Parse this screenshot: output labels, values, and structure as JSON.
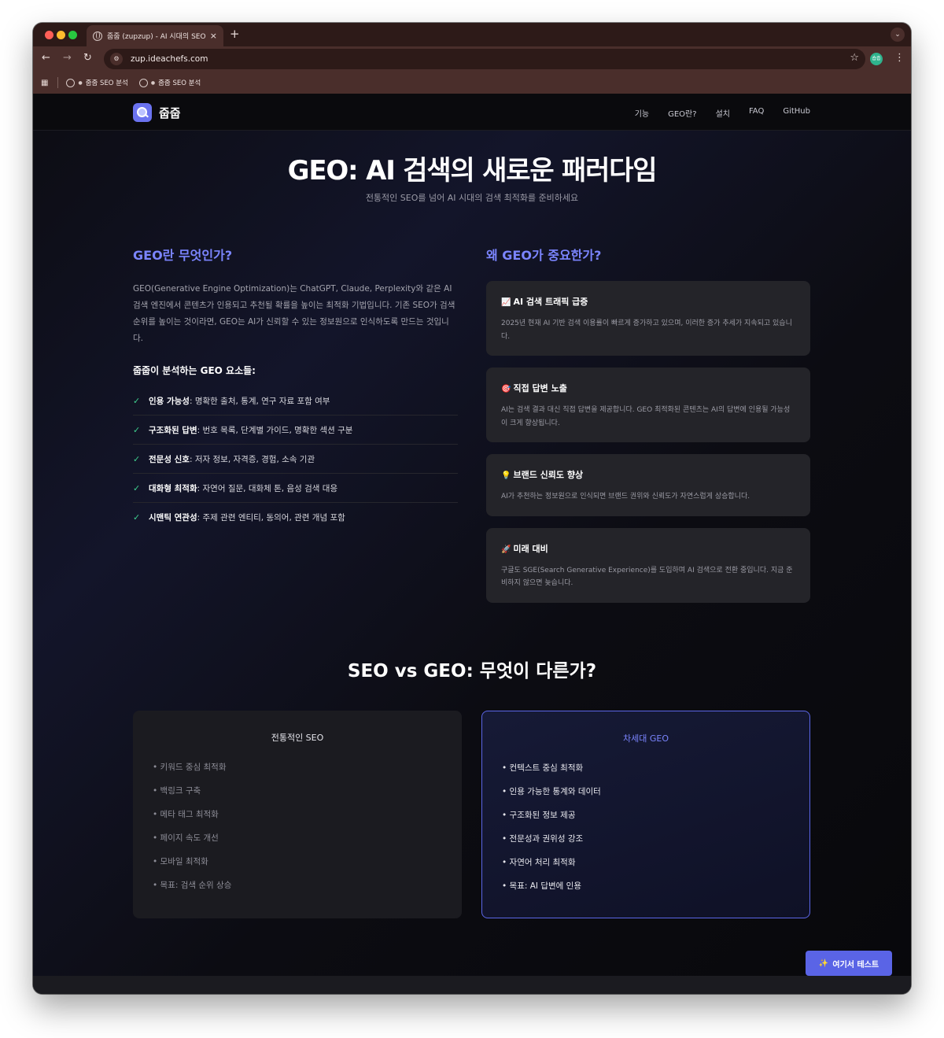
{
  "browser": {
    "tab_title": "줍줍 (zupzup) - AI 시대의 SEO 분석",
    "tab_close": "×",
    "new_tab": "+",
    "url": "zup.ideachefs.com",
    "profile_initials": "숍줍",
    "bookmarks": [
      {
        "label": "줍줍 SEO 분석"
      },
      {
        "label": "줍줍 SEO 분석"
      }
    ]
  },
  "site": {
    "logo_text": "줍줍",
    "nav": [
      "기능",
      "GEO란?",
      "설치",
      "FAQ",
      "GitHub"
    ]
  },
  "hero": {
    "title": "GEO: AI 검색의 새로운 패러다임",
    "subtitle": "전통적인 SEO를 넘어 AI 시대의 검색 최적화를 준비하세요"
  },
  "what_is": {
    "heading": "GEO란 무엇인가?",
    "description": "GEO(Generative Engine Optimization)는 ChatGPT, Claude, Perplexity와 같은 AI 검색 엔진에서 콘텐츠가 인용되고 추천될 확률을 높이는 최적화 기법입니다. 기존 SEO가 검색 순위를 높이는 것이라면, GEO는 AI가 신뢰할 수 있는 정보원으로 인식하도록 만드는 것입니다.",
    "factors_heading": "줍줍이 분석하는 GEO 요소들:",
    "factors": [
      {
        "name": "인용 가능성",
        "detail": ": 명확한 출처, 통계, 연구 자료 포함 여부"
      },
      {
        "name": "구조화된 답변",
        "detail": ": 번호 목록, 단계별 가이드, 명확한 섹션 구분"
      },
      {
        "name": "전문성 신호",
        "detail": ": 저자 정보, 자격증, 경험, 소속 기관"
      },
      {
        "name": "대화형 최적화",
        "detail": ": 자연어 질문, 대화체 톤, 음성 검색 대응"
      },
      {
        "name": "시맨틱 연관성",
        "detail": ": 주제 관련 엔티티, 동의어, 관련 개념 포함"
      }
    ]
  },
  "why": {
    "heading": "왜 GEO가 중요한가?",
    "cards": [
      {
        "emoji": "📈",
        "title": "AI 검색 트래픽 급증",
        "text": "2025년 현재 AI 기반 검색 이용률이 빠르게 증가하고 있으며, 이러한 증가 추세가 지속되고 있습니다."
      },
      {
        "emoji": "🎯",
        "title": "직접 답변 노출",
        "text": "AI는 검색 결과 대신 직접 답변을 제공합니다. GEO 최적화된 콘텐츠는 AI의 답변에 인용될 가능성이 크게 향상됩니다."
      },
      {
        "emoji": "💡",
        "title": "브랜드 신뢰도 향상",
        "text": "AI가 추천하는 정보원으로 인식되면 브랜드 권위와 신뢰도가 자연스럽게 상승합니다."
      },
      {
        "emoji": "🚀",
        "title": "미래 대비",
        "text": "구글도 SGE(Search Generative Experience)를 도입하며 AI 검색으로 전환 중입니다. 지금 준비하지 않으면 늦습니다."
      }
    ]
  },
  "comparison": {
    "heading": "SEO vs GEO: 무엇이 다른가?",
    "seo": {
      "title": "전통적인 SEO",
      "items": [
        "키워드 중심 최적화",
        "백링크 구축",
        "메타 태그 최적화",
        "페이지 속도 개선",
        "모바일 최적화",
        "목표: 검색 순위 상승"
      ]
    },
    "geo": {
      "title": "차세대 GEO",
      "items": [
        "컨텍스트 중심 최적화",
        "인용 가능한 통계와 데이터",
        "구조화된 정보 제공",
        "전문성과 권위성 강조",
        "자연어 처리 최적화",
        "목표: AI 답변에 인용"
      ]
    }
  },
  "cta": {
    "emoji": "✨",
    "label": "여기서 테스트"
  }
}
